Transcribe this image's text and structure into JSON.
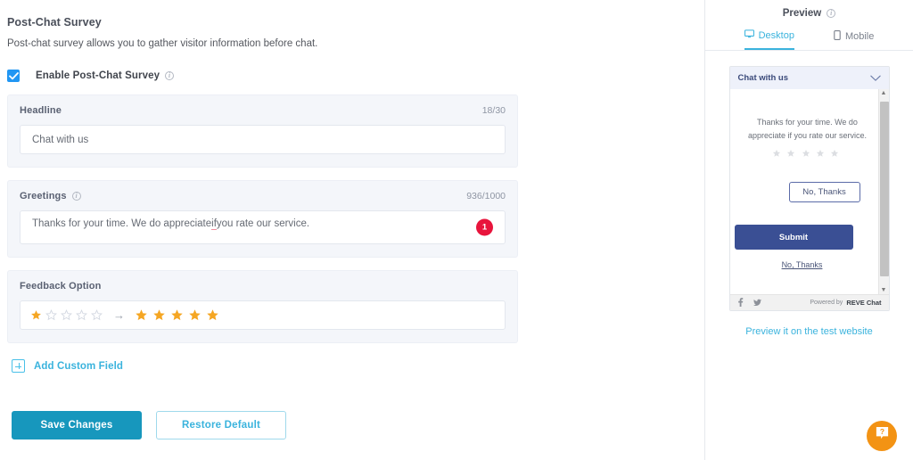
{
  "settings": {
    "title": "Post-Chat Survey",
    "description": "Post-chat survey allows you to gather visitor information before chat.",
    "enable_label": "Enable Post-Chat Survey",
    "enable_checked": true,
    "sections": {
      "headline": {
        "label": "Headline",
        "counter": "18/30",
        "value": "Chat with us"
      },
      "greetings": {
        "label": "Greetings",
        "counter": "936/1000",
        "value": "Thanks for your time. We do appreciate if you rate our service.",
        "value_part_1": "Thanks for your time. We do appreciate ",
        "value_spell": "if",
        "value_part_2": " you rate our service.",
        "badge": "1"
      },
      "feedback": {
        "label": "Feedback Option",
        "arrow": "→",
        "left_filled": 1,
        "left_total": 5,
        "right_filled": 5,
        "right_total": 5
      }
    },
    "add_custom_field": "Add Custom Field",
    "save_button": "Save Changes",
    "restore_button": "Restore Default"
  },
  "preview": {
    "title": "Preview",
    "tabs": [
      {
        "label": "Desktop",
        "icon": "monitor-icon",
        "active": true
      },
      {
        "label": "Mobile",
        "icon": "phone-icon",
        "active": false
      }
    ],
    "widget": {
      "header_title": "Chat with us",
      "message": "Thanks for your time. We do appreciate if you rate our service.",
      "stars_total": 5,
      "stars_filled": 0,
      "no_thanks_button": "No, Thanks",
      "submit_button": "Submit",
      "no_thanks_link": "No, Thanks",
      "powered_by": "Powered by",
      "brand": "REVE Chat",
      "social": [
        "facebook-icon",
        "twitter-icon"
      ]
    },
    "test_link": "Preview it on the test website"
  },
  "help": {
    "icon": "question-bubble-icon"
  },
  "colors": {
    "accent": "#3ab3dd",
    "primary_button": "#1797bd",
    "checkbox": "#2196f3",
    "star_filled": "#f5a623",
    "star_empty": "#d6dae2",
    "badge_red": "#e8143c",
    "widget_blue": "#3a4f94",
    "help_orange": "#f39314",
    "panel_bg": "#f4f6fa"
  }
}
